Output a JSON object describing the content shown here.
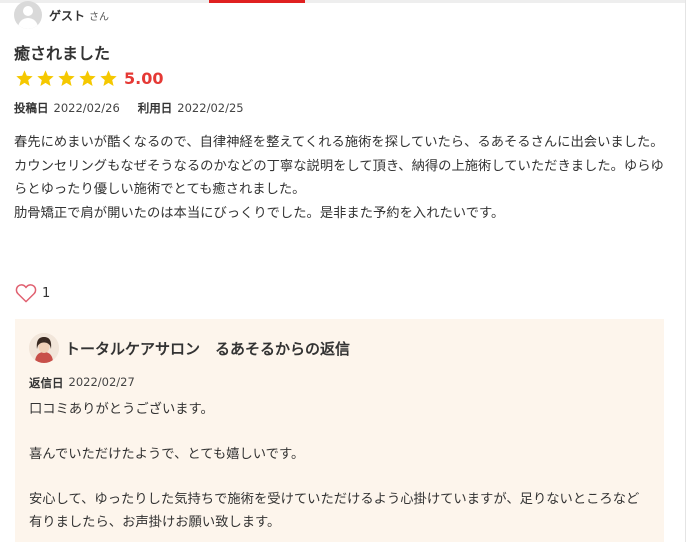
{
  "reviewer": {
    "name": "ゲスト",
    "suffix": "さん"
  },
  "review": {
    "title": "癒されました",
    "rating_value": "5.00",
    "stars": 5,
    "posted_label": "投稿日",
    "posted_date": "2022/02/26",
    "used_label": "利用日",
    "used_date": "2022/02/25",
    "body": "春先にめまいが酷くなるので、自律神経を整えてくれる施術を探していたら、るあそるさんに出会いました。カウンセリングもなぜそうなるのかなどの丁寧な説明をして頂き、納得の上施術していただきました。ゆらゆらとゆったり優しい施術でとても癒されました。\n肋骨矯正で肩が開いたのは本当にびっくりでした。是非また予約を入れたいです。"
  },
  "like": {
    "count": "1"
  },
  "reply": {
    "title": "トータルケアサロン　るあそるからの返信",
    "date_label": "返信日",
    "date": "2022/02/27",
    "body": "口コミありがとうございます。\n\n喜んでいただけたようで、とても嬉しいです。\n\n安心して、ゆったりした気持ちで施術を受けていただけるよう心掛けていますが、足りないところなど有りましたら、お声掛けお願い致します。"
  },
  "colors": {
    "star": "#f5c800",
    "rating": "#e53935",
    "heart": "#e06070",
    "reply_bg": "#fdf5ec",
    "accent": "#e02020"
  },
  "icons": {
    "star": "star-icon",
    "heart": "heart-icon",
    "avatar": "user-avatar-icon"
  }
}
